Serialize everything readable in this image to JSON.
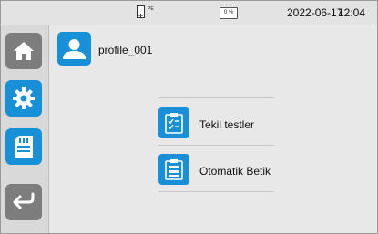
{
  "status": {
    "pe_label": "PE",
    "battery_text": "0 %",
    "date": "2022-06-17",
    "time": "12:04"
  },
  "sidebar": {
    "items": [
      {
        "icon": "home-icon"
      },
      {
        "icon": "gear-icon"
      },
      {
        "icon": "memory-card-icon"
      },
      {
        "icon": "back-arrow-icon"
      }
    ]
  },
  "profile": {
    "name": "profile_001",
    "icon": "user-icon"
  },
  "menu": {
    "items": [
      {
        "label": "Tekil testler",
        "icon": "checklist-icon"
      },
      {
        "label": "Otomatik Betik",
        "icon": "script-icon"
      }
    ]
  },
  "colors": {
    "accent": "#1790d8",
    "disabled": "#7d7d7d"
  }
}
